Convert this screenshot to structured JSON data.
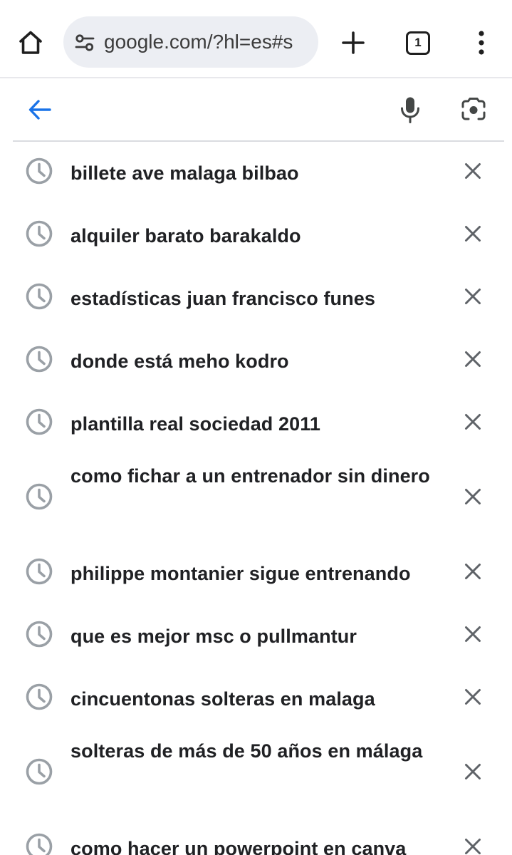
{
  "browser": {
    "url": "google.com/?hl=es#s",
    "tab_count": "1",
    "icons": {
      "home": "home-icon",
      "site_settings": "tune-icon",
      "new_tab": "plus-icon",
      "tabs": "tab-switcher-icon",
      "menu": "more-vert-icon"
    }
  },
  "search": {
    "value": "",
    "placeholder": "",
    "icons": {
      "back": "arrow-left-icon",
      "voice": "mic-icon",
      "lens": "camera-lens-icon"
    },
    "accent_color": "#1a73e8"
  },
  "suggestions": [
    {
      "text": "billete ave malaga bilbao"
    },
    {
      "text": "alquiler barato barakaldo"
    },
    {
      "text": "estadísticas juan francisco funes"
    },
    {
      "text": "donde está meho kodro"
    },
    {
      "text": "plantilla real sociedad 2011"
    },
    {
      "text": "como fichar a un entrenador sin dinero"
    },
    {
      "text": "philippe montanier sigue entrenando"
    },
    {
      "text": "que es mejor msc o pullmantur"
    },
    {
      "text": "cincuentonas solteras en malaga"
    },
    {
      "text": "solteras de más de 50 años en málaga"
    },
    {
      "text": "como hacer un powerpoint en canva"
    }
  ]
}
